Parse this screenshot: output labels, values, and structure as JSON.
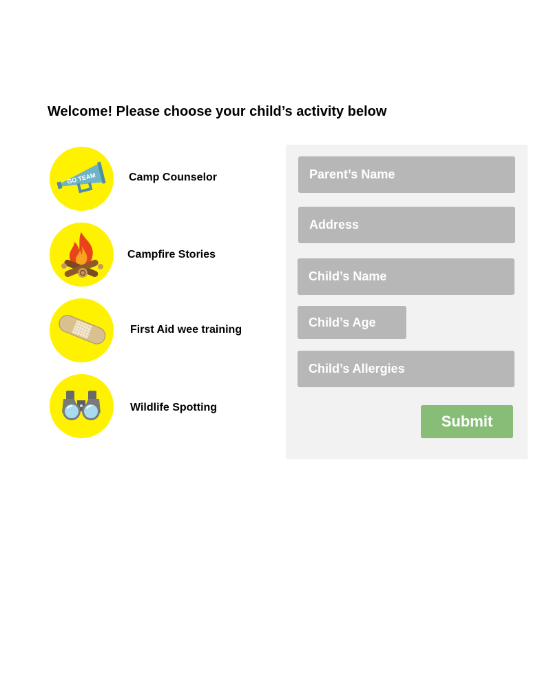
{
  "heading": "Welcome! Please choose your child’s activity below",
  "activities": [
    {
      "label": "Camp Counselor",
      "icon": "megaphone-icon",
      "icon_text": "GO TEAM"
    },
    {
      "label": "Campfire Stories",
      "icon": "campfire-icon"
    },
    {
      "label": "First Aid wee training",
      "icon": "bandage-icon"
    },
    {
      "label": "Wildlife Spotting",
      "icon": "binoculars-icon"
    }
  ],
  "form": {
    "parent_name": {
      "placeholder": "Parent’s Name",
      "value": ""
    },
    "address": {
      "placeholder": "Address",
      "value": ""
    },
    "child_name": {
      "placeholder": "Child’s Name",
      "value": ""
    },
    "child_age": {
      "placeholder": "Child’s Age",
      "value": ""
    },
    "child_allergies": {
      "placeholder": "Child’s Allergies",
      "value": ""
    },
    "submit_label": "Submit"
  },
  "colors": {
    "icon_circle": "#fff200",
    "input_bg": "#b7b7b7",
    "panel_bg": "#f2f2f2",
    "submit_bg": "#88bd78"
  }
}
